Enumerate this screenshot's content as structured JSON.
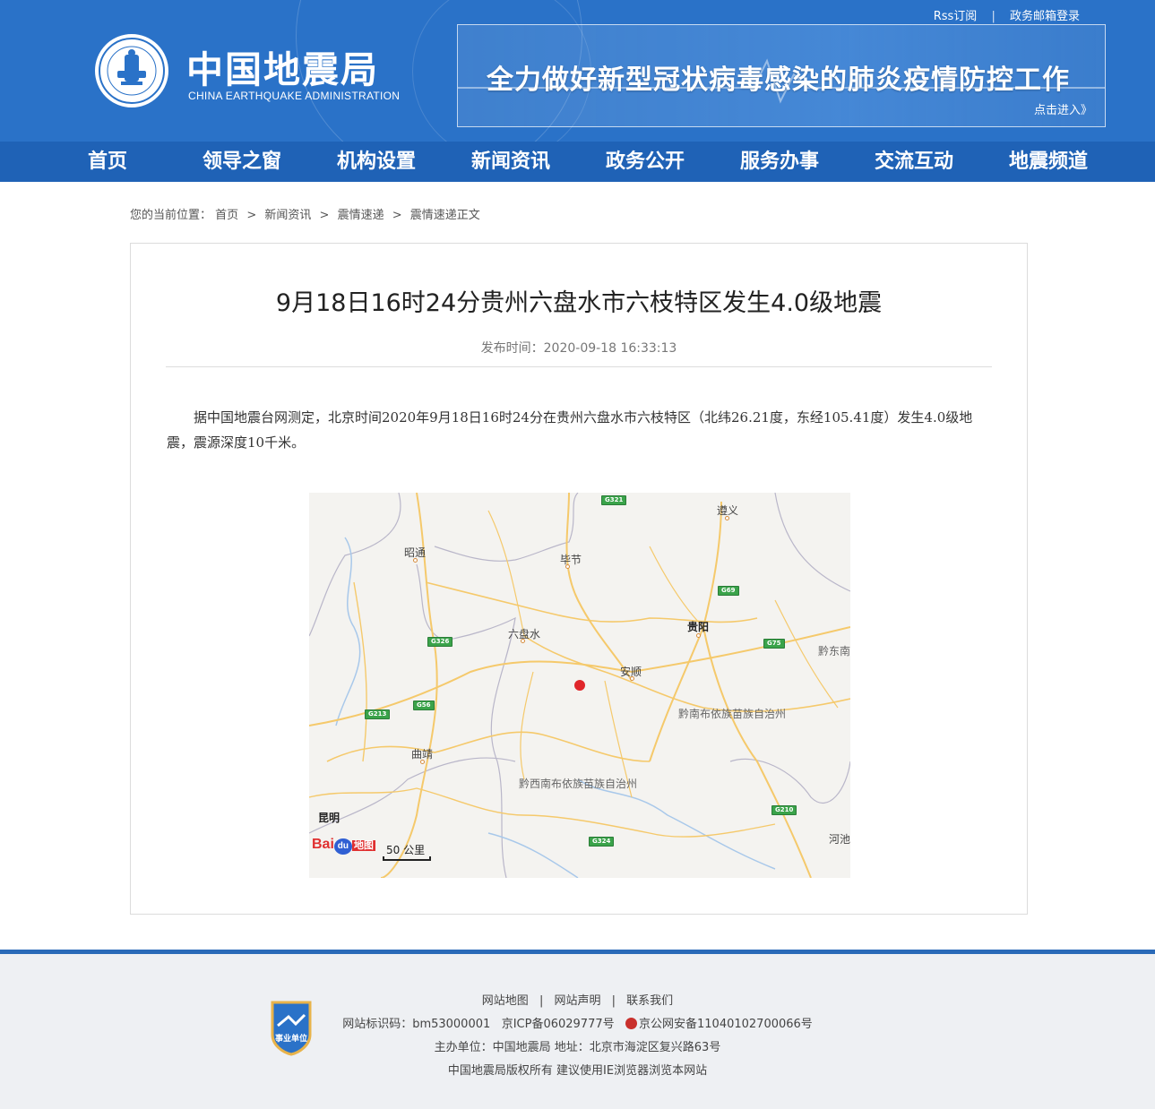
{
  "header": {
    "rss": "Rss订阅",
    "mail": "政务邮箱登录",
    "logo_cn": "中国地震局",
    "logo_en": "CHINA EARTHQUAKE ADMINISTRATION",
    "banner_title": "全力做好新型冠状病毒感染的肺炎疫情防控工作",
    "banner_enter": "点击进入》"
  },
  "nav": [
    "首页",
    "领导之窗",
    "机构设置",
    "新闻资讯",
    "政务公开",
    "服务办事",
    "交流互动",
    "地震频道"
  ],
  "breadcrumb": {
    "prefix": "您的当前位置：",
    "items": [
      "首页",
      "新闻资讯",
      "震情速递",
      "震情速递正文"
    ],
    "separator": ">"
  },
  "article": {
    "title": "9月18日16时24分贵州六盘水市六枝特区发生4.0级地震",
    "publish_time": "发布时间：2020-09-18 16:33:13",
    "body": "据中国地震台网测定，北京时间2020年9月18日16时24分在贵州六盘水市六枝特区（北纬26.21度，东经105.41度）发生4.0级地震，震源深度10千米。"
  },
  "map": {
    "cities": [
      "遵义",
      "昭通",
      "毕节",
      "贵阳",
      "六盘水",
      "安顺",
      "黔东南",
      "黔南布依族苗族自治州",
      "曲靖",
      "黔西南布依族苗族自治州",
      "昆明",
      "河池"
    ],
    "highways": [
      "G321",
      "G69",
      "G326",
      "G75",
      "G56",
      "G213",
      "G210",
      "G324"
    ],
    "logo": "Bai",
    "logo_du": "du",
    "logo_tu": "地图",
    "scale": "50 公里",
    "marker_color": "#e0262a"
  },
  "footer": {
    "links": [
      "网站地图",
      "网站声明",
      "联系我们"
    ],
    "id_line": "网站标识码：bm53000001",
    "icp": "京ICP备06029777号",
    "police": "京公网安备11040102700066号",
    "host": "主办单位：中国地震局  地址：北京市海淀区复兴路63号",
    "copyright": "中国地震局版权所有  建议使用IE浏览器浏览本网站",
    "badge": "事业单位"
  },
  "colors": {
    "header_blue": "#2a72c8",
    "nav_blue": "#1f62b6",
    "footer_bg": "#eef0f3"
  }
}
